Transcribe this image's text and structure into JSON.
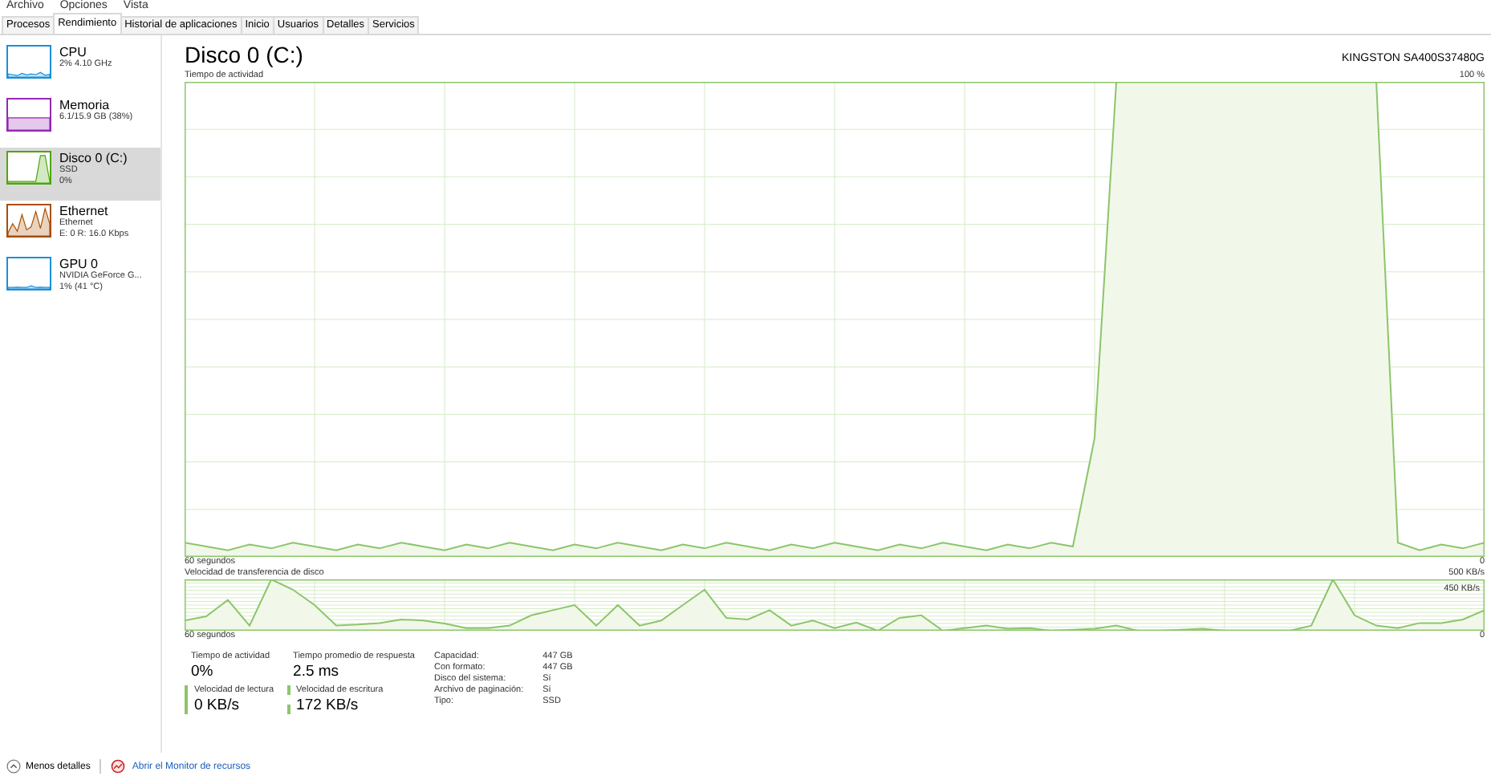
{
  "menu": [
    "Archivo",
    "Opciones",
    "Vista"
  ],
  "tabs": [
    {
      "label": "Procesos",
      "selected": false
    },
    {
      "label": "Rendimiento",
      "selected": true
    },
    {
      "label": "Historial de aplicaciones",
      "selected": false
    },
    {
      "label": "Inicio",
      "selected": false
    },
    {
      "label": "Usuarios",
      "selected": false
    },
    {
      "label": "Detalles",
      "selected": false
    },
    {
      "label": "Servicios",
      "selected": false
    }
  ],
  "sidebar": {
    "items": [
      {
        "name": "CPU",
        "details": [
          "2% 4.10 GHz"
        ],
        "color": "#1a90d8",
        "selected": false
      },
      {
        "name": "Memoria",
        "details": [
          "6.1/15.9 GB (38%)"
        ],
        "color": "#9528b4",
        "selected": false
      },
      {
        "name": "Disco 0 (C:)",
        "details": [
          "SSD",
          "0%"
        ],
        "color": "#4da60c",
        "selected": true
      },
      {
        "name": "Ethernet",
        "details": [
          "Ethernet",
          "E: 0 R: 16.0 Kbps"
        ],
        "color": "#a74f01",
        "selected": false
      },
      {
        "name": "GPU 0",
        "details": [
          "NVIDIA GeForce G...",
          "1% (41 °C)"
        ],
        "color": "#1a90d8",
        "selected": false
      }
    ]
  },
  "main": {
    "title": "Disco 0 (C:)",
    "model": "KINGSTON SA400S37480G",
    "activity_graph": {
      "label": "Tiempo de actividad",
      "max": "100 %",
      "time": "60 segundos",
      "min": "0"
    },
    "transfer_graph": {
      "label": "Velocidad de transferencia de disco",
      "max": "500 KB/s",
      "marker": "450 KB/s",
      "time": "60 segundos",
      "min": "0"
    },
    "stats": [
      {
        "kind": "plain",
        "label": "Tiempo de actividad",
        "value": "0%"
      },
      {
        "kind": "plain",
        "label": "Tiempo promedio de respuesta",
        "value": "2.5 ms"
      },
      {
        "kind": "read",
        "label": "Velocidad de lectura",
        "value": "0 KB/s"
      },
      {
        "kind": "write",
        "label": "Velocidad de escritura",
        "value": "172 KB/s"
      }
    ],
    "properties": [
      {
        "label": "Capacidad:",
        "value": "447 GB"
      },
      {
        "label": "Con formato:",
        "value": "447 GB"
      },
      {
        "label": "Disco del sistema:",
        "value": "Sí"
      },
      {
        "label": "Archivo de paginación:",
        "value": "Sí"
      },
      {
        "label": "Tipo:",
        "value": "SSD"
      }
    ]
  },
  "footer": {
    "less_details": "Menos detalles",
    "resource_monitor": "Abrir el Monitor de recursos"
  }
}
